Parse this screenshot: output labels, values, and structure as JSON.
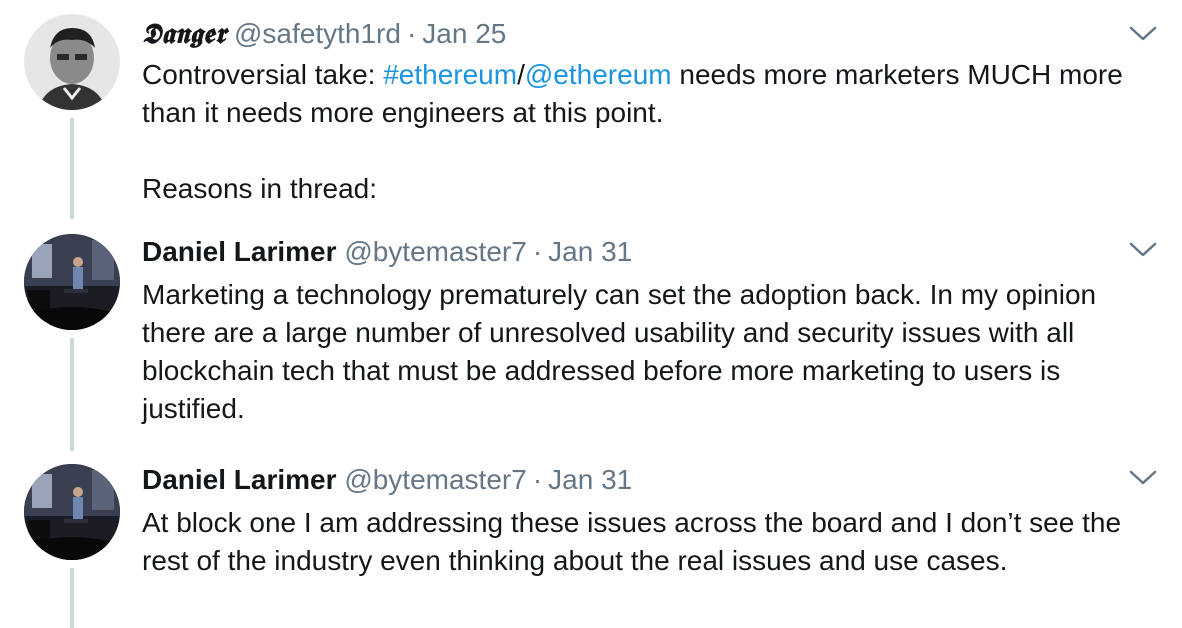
{
  "tweets": [
    {
      "display_name": "𝕯𝖆𝖓𝖌𝖊𝖗",
      "handle": "@safetyth1rd",
      "separator": "·",
      "date": "Jan 25",
      "text_prefix": "Controversial take: ",
      "hashtag": "#ethereum",
      "slash": "/",
      "mention": "@ethereum",
      "text_suffix": " needs more marketers MUCH more than it needs more engineers at this point.",
      "text_line2": "Reasons in thread:"
    },
    {
      "display_name": "Daniel Larimer",
      "handle": "@bytemaster7",
      "separator": "·",
      "date": "Jan 31",
      "text": "Marketing a technology prematurely can set the adoption back. In my opinion there are a large number of unresolved usability and security issues with all blockchain tech that must be addressed before more marketing to users is justified."
    },
    {
      "display_name": "Daniel Larimer",
      "handle": "@bytemaster7",
      "separator": "·",
      "date": "Jan 31",
      "text": "At block one I am addressing these issues across the board and I don’t see the rest of the industry even thinking about the real issues and use cases."
    }
  ],
  "colors": {
    "text": "#14171a",
    "secondary": "#657786",
    "link": "#1b95e0",
    "thread_line": "#ccd6dd"
  },
  "icons": {
    "caret": "chevron-down-icon",
    "avatar": "user-photo"
  }
}
